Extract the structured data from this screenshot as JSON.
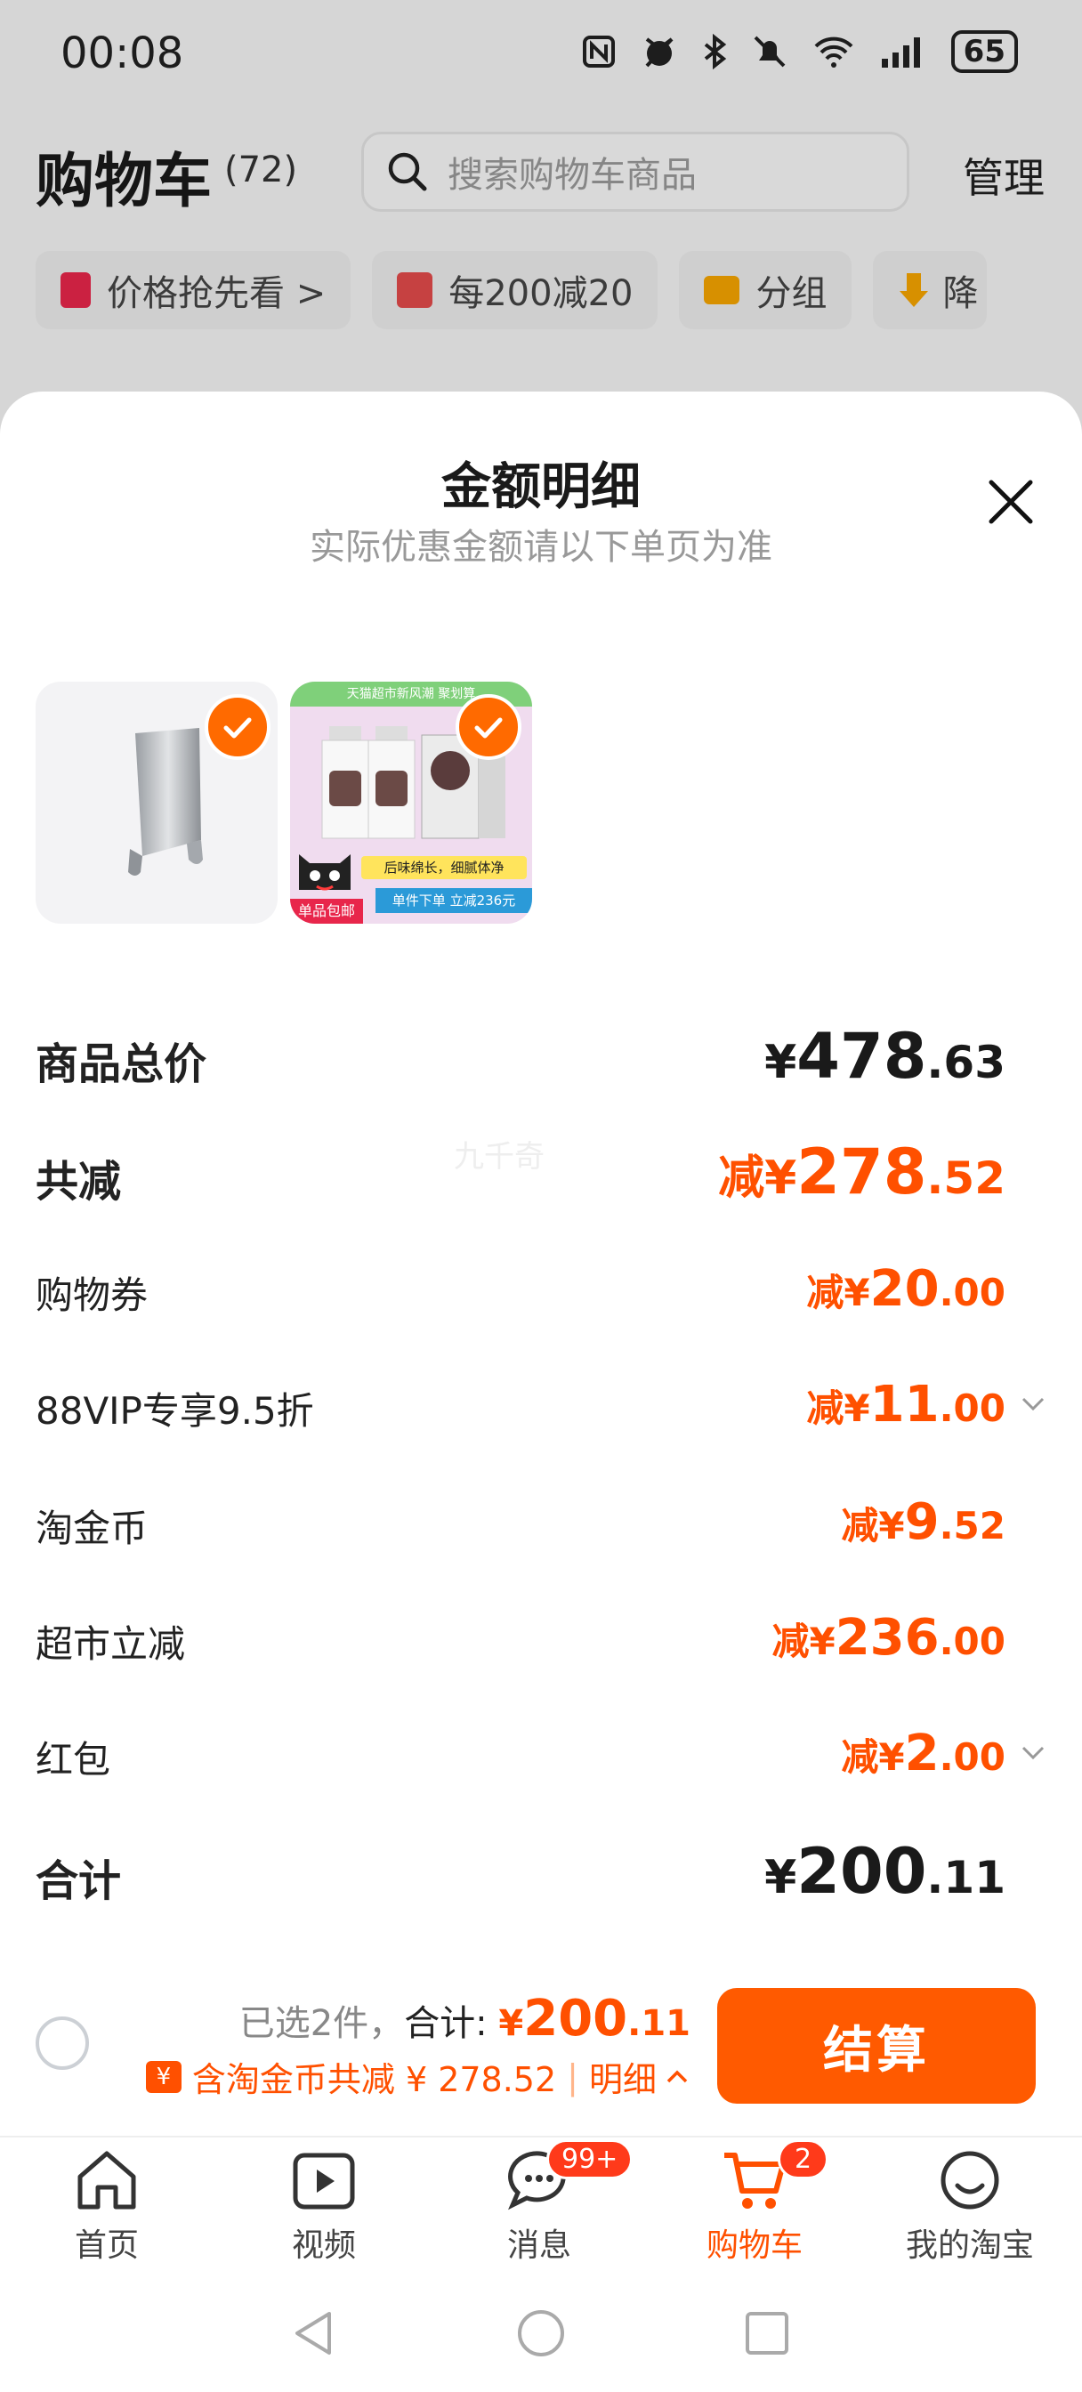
{
  "status_bar": {
    "time": "00:08",
    "icons": [
      "nfc-icon",
      "alarm-icon",
      "bluetooth-icon",
      "mute-icon",
      "wifi-icon",
      "signal-icon"
    ],
    "battery": "65"
  },
  "header": {
    "title": "购物车",
    "count": "(72)",
    "search_placeholder": "搜索购物车商品",
    "manage_label": "管理"
  },
  "chips": [
    {
      "label": "价格抢先看 >",
      "icon": "price-tag-icon",
      "color": "#e8264b"
    },
    {
      "label": "每200减20",
      "icon": "shop-icon",
      "color": "#e24a4a"
    },
    {
      "label": "分组",
      "icon": "folder-icon",
      "color": "#f5a400"
    },
    {
      "label": "降",
      "icon": "down-arrow-icon",
      "color": "#f5a400"
    }
  ],
  "sheet": {
    "title": "金额明细",
    "subtitle": "实际优惠金额请以下单页为准",
    "watermark": "九千奇",
    "thumb2": {
      "top_banner": "天猫超市新风潮 聚划算",
      "tagline": "后味绵长，细腻体净",
      "promo": "单件下单 立减236元",
      "corner": "单品包邮"
    },
    "rows": [
      {
        "label": "商品总价",
        "prefix": "¥",
        "int": "478",
        "dec": ".63",
        "style": "total",
        "chevron": false
      },
      {
        "label": "共减",
        "prefix": "减¥",
        "int": "278",
        "dec": ".52",
        "style": "total-discount",
        "chevron": false
      },
      {
        "label": "购物券",
        "prefix": "减¥",
        "int": "20",
        "dec": ".00",
        "style": "item",
        "chevron": false
      },
      {
        "label": "88VIP专享9.5折",
        "prefix": "减¥",
        "int": "11",
        "dec": ".00",
        "style": "item",
        "chevron": true
      },
      {
        "label": "淘金币",
        "prefix": "减¥",
        "int": "9",
        "dec": ".52",
        "style": "item",
        "chevron": false
      },
      {
        "label": "超市立减",
        "prefix": "减¥",
        "int": "236",
        "dec": ".00",
        "style": "item",
        "chevron": false
      },
      {
        "label": "红包",
        "prefix": "减¥",
        "int": "2",
        "dec": ".00",
        "style": "item",
        "chevron": true
      },
      {
        "label": "合计",
        "prefix": "¥",
        "int": "200",
        "dec": ".11",
        "style": "total",
        "chevron": false
      }
    ]
  },
  "bottom": {
    "selected_text": "已选2件，",
    "total_label": "合计: ",
    "total_prefix": "¥",
    "total_int": "200",
    "total_dec": ".11",
    "savings_text": "含淘金币共减 ¥ 278.52",
    "detail_label": "明细",
    "checkout_label": "结算"
  },
  "tabs": [
    {
      "label": "首页",
      "icon": "home-icon",
      "active": false,
      "badge": ""
    },
    {
      "label": "视频",
      "icon": "video-icon",
      "active": false,
      "badge": ""
    },
    {
      "label": "消息",
      "icon": "message-icon",
      "active": false,
      "badge": "99+"
    },
    {
      "label": "购物车",
      "icon": "cart-icon",
      "active": true,
      "badge": "2"
    },
    {
      "label": "我的淘宝",
      "icon": "profile-icon",
      "active": false,
      "badge": ""
    }
  ],
  "colors": {
    "accent": "#ff5000",
    "checkout": "#ff5a00",
    "badge": "#ff3a1a"
  }
}
